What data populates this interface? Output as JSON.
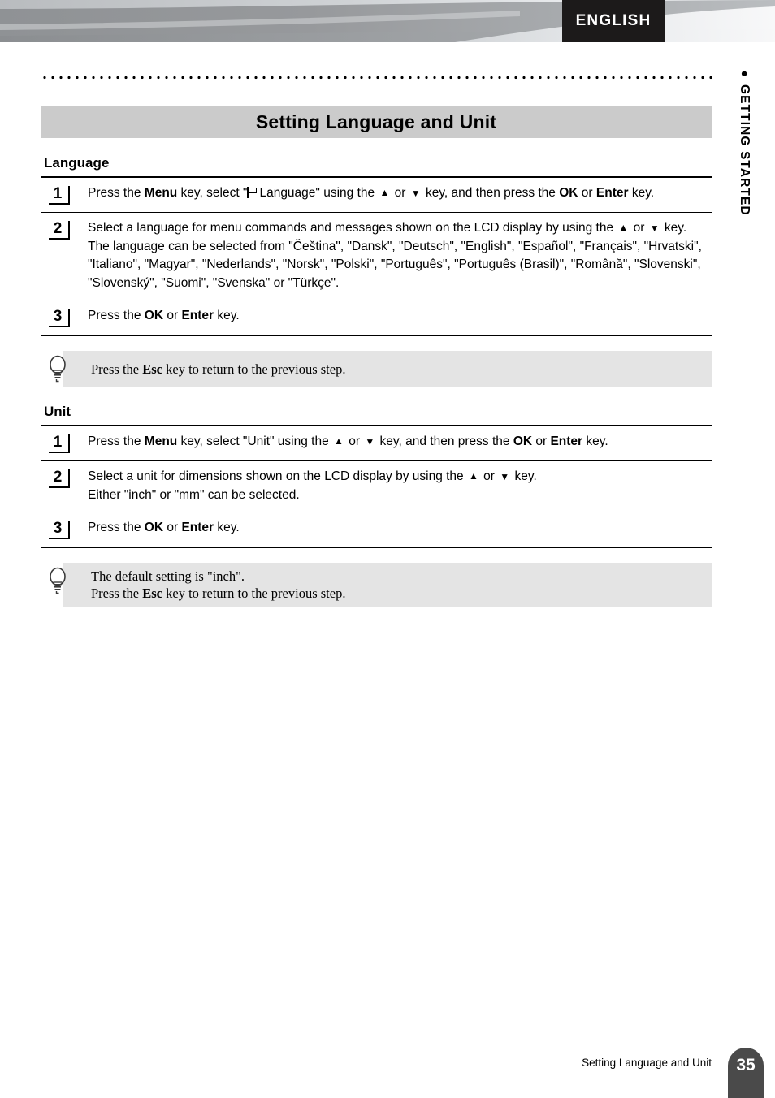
{
  "header": {
    "language_tab": "ENGLISH",
    "side_tab_label": "GETTING STARTED",
    "side_tab_bullet": "●"
  },
  "page": {
    "title": "Setting Language and Unit",
    "footer_text": "Setting Language and Unit",
    "page_number": "35"
  },
  "sections": [
    {
      "heading": "Language",
      "steps": [
        {
          "number": "1",
          "lines": [
            {
              "parts": [
                {
                  "t": "Press the "
                },
                {
                  "t": "Menu",
                  "b": true
                },
                {
                  "t": " key, select \""
                },
                {
                  "icon": "flag-icon"
                },
                {
                  "t": "Language\" using the "
                },
                {
                  "icon": "arrow-up-icon"
                },
                {
                  "t": " or "
                },
                {
                  "icon": "arrow-down-icon"
                },
                {
                  "t": " key, and then press the "
                },
                {
                  "t": "OK",
                  "b": true
                },
                {
                  "t": " or "
                },
                {
                  "t": "Enter",
                  "b": true
                },
                {
                  "t": " key."
                }
              ]
            }
          ]
        },
        {
          "number": "2",
          "lines": [
            {
              "parts": [
                {
                  "t": "Select a language for menu commands and messages shown on the LCD display by using the "
                },
                {
                  "icon": "arrow-up-icon"
                },
                {
                  "t": " or "
                },
                {
                  "icon": "arrow-down-icon"
                },
                {
                  "t": " key."
                }
              ]
            },
            {
              "parts": [
                {
                  "t": "The language can be selected from \"Čeština\", \"Dansk\", \"Deutsch\", \"English\", \"Español\", \"Français\", \"Hrvatski\", \"Italiano\", \"Magyar\", \"Nederlands\", \"Norsk\", \"Polski\", \"Português\", \"Português (Brasil)\", \"Română\", \"Slovenski\", \"Slovenský\", \"Suomi\", \"Svenska\" or \"Türkçe\"."
                }
              ]
            }
          ]
        },
        {
          "number": "3",
          "lines": [
            {
              "parts": [
                {
                  "t": "Press the "
                },
                {
                  "t": "OK",
                  "b": true
                },
                {
                  "t": " or "
                },
                {
                  "t": "Enter",
                  "b": true
                },
                {
                  "t": " key."
                }
              ]
            }
          ]
        }
      ],
      "tip": {
        "icon": "lightbulb-icon",
        "lines": [
          {
            "parts": [
              {
                "t": "Press the "
              },
              {
                "t": "Esc",
                "b": true
              },
              {
                "t": " key to return to the previous step."
              }
            ]
          }
        ]
      }
    },
    {
      "heading": "Unit",
      "steps": [
        {
          "number": "1",
          "lines": [
            {
              "parts": [
                {
                  "t": "Press the "
                },
                {
                  "t": "Menu",
                  "b": true
                },
                {
                  "t": " key, select \"Unit\" using the "
                },
                {
                  "icon": "arrow-up-icon"
                },
                {
                  "t": " or "
                },
                {
                  "icon": "arrow-down-icon"
                },
                {
                  "t": " key, and then press the "
                },
                {
                  "t": "OK",
                  "b": true
                },
                {
                  "t": " or "
                },
                {
                  "t": "Enter",
                  "b": true
                },
                {
                  "t": " key."
                }
              ]
            }
          ]
        },
        {
          "number": "2",
          "lines": [
            {
              "parts": [
                {
                  "t": "Select a unit for dimensions shown on the LCD display by using the "
                },
                {
                  "icon": "arrow-up-icon"
                },
                {
                  "t": " or "
                },
                {
                  "icon": "arrow-down-icon"
                },
                {
                  "t": " key."
                }
              ]
            },
            {
              "parts": [
                {
                  "t": "Either \"inch\" or \"mm\" can be selected."
                }
              ]
            }
          ]
        },
        {
          "number": "3",
          "lines": [
            {
              "parts": [
                {
                  "t": "Press the "
                },
                {
                  "t": "OK",
                  "b": true
                },
                {
                  "t": " or "
                },
                {
                  "t": "Enter",
                  "b": true
                },
                {
                  "t": " key."
                }
              ]
            }
          ]
        }
      ],
      "tip": {
        "icon": "lightbulb-icon",
        "lines": [
          {
            "parts": [
              {
                "t": "The default setting is \"inch\"."
              }
            ]
          },
          {
            "parts": [
              {
                "t": "Press the "
              },
              {
                "t": "Esc",
                "b": true
              },
              {
                "t": " key to return to the previous step."
              }
            ]
          }
        ]
      }
    }
  ],
  "colors": {
    "title_bar": "#cbcbcb",
    "tip_bg": "#e4e4e4",
    "lang_tab_bg": "#1c1a1a",
    "page_tab_bg": "#4a4a4a",
    "banner_gray": "#94979a"
  }
}
